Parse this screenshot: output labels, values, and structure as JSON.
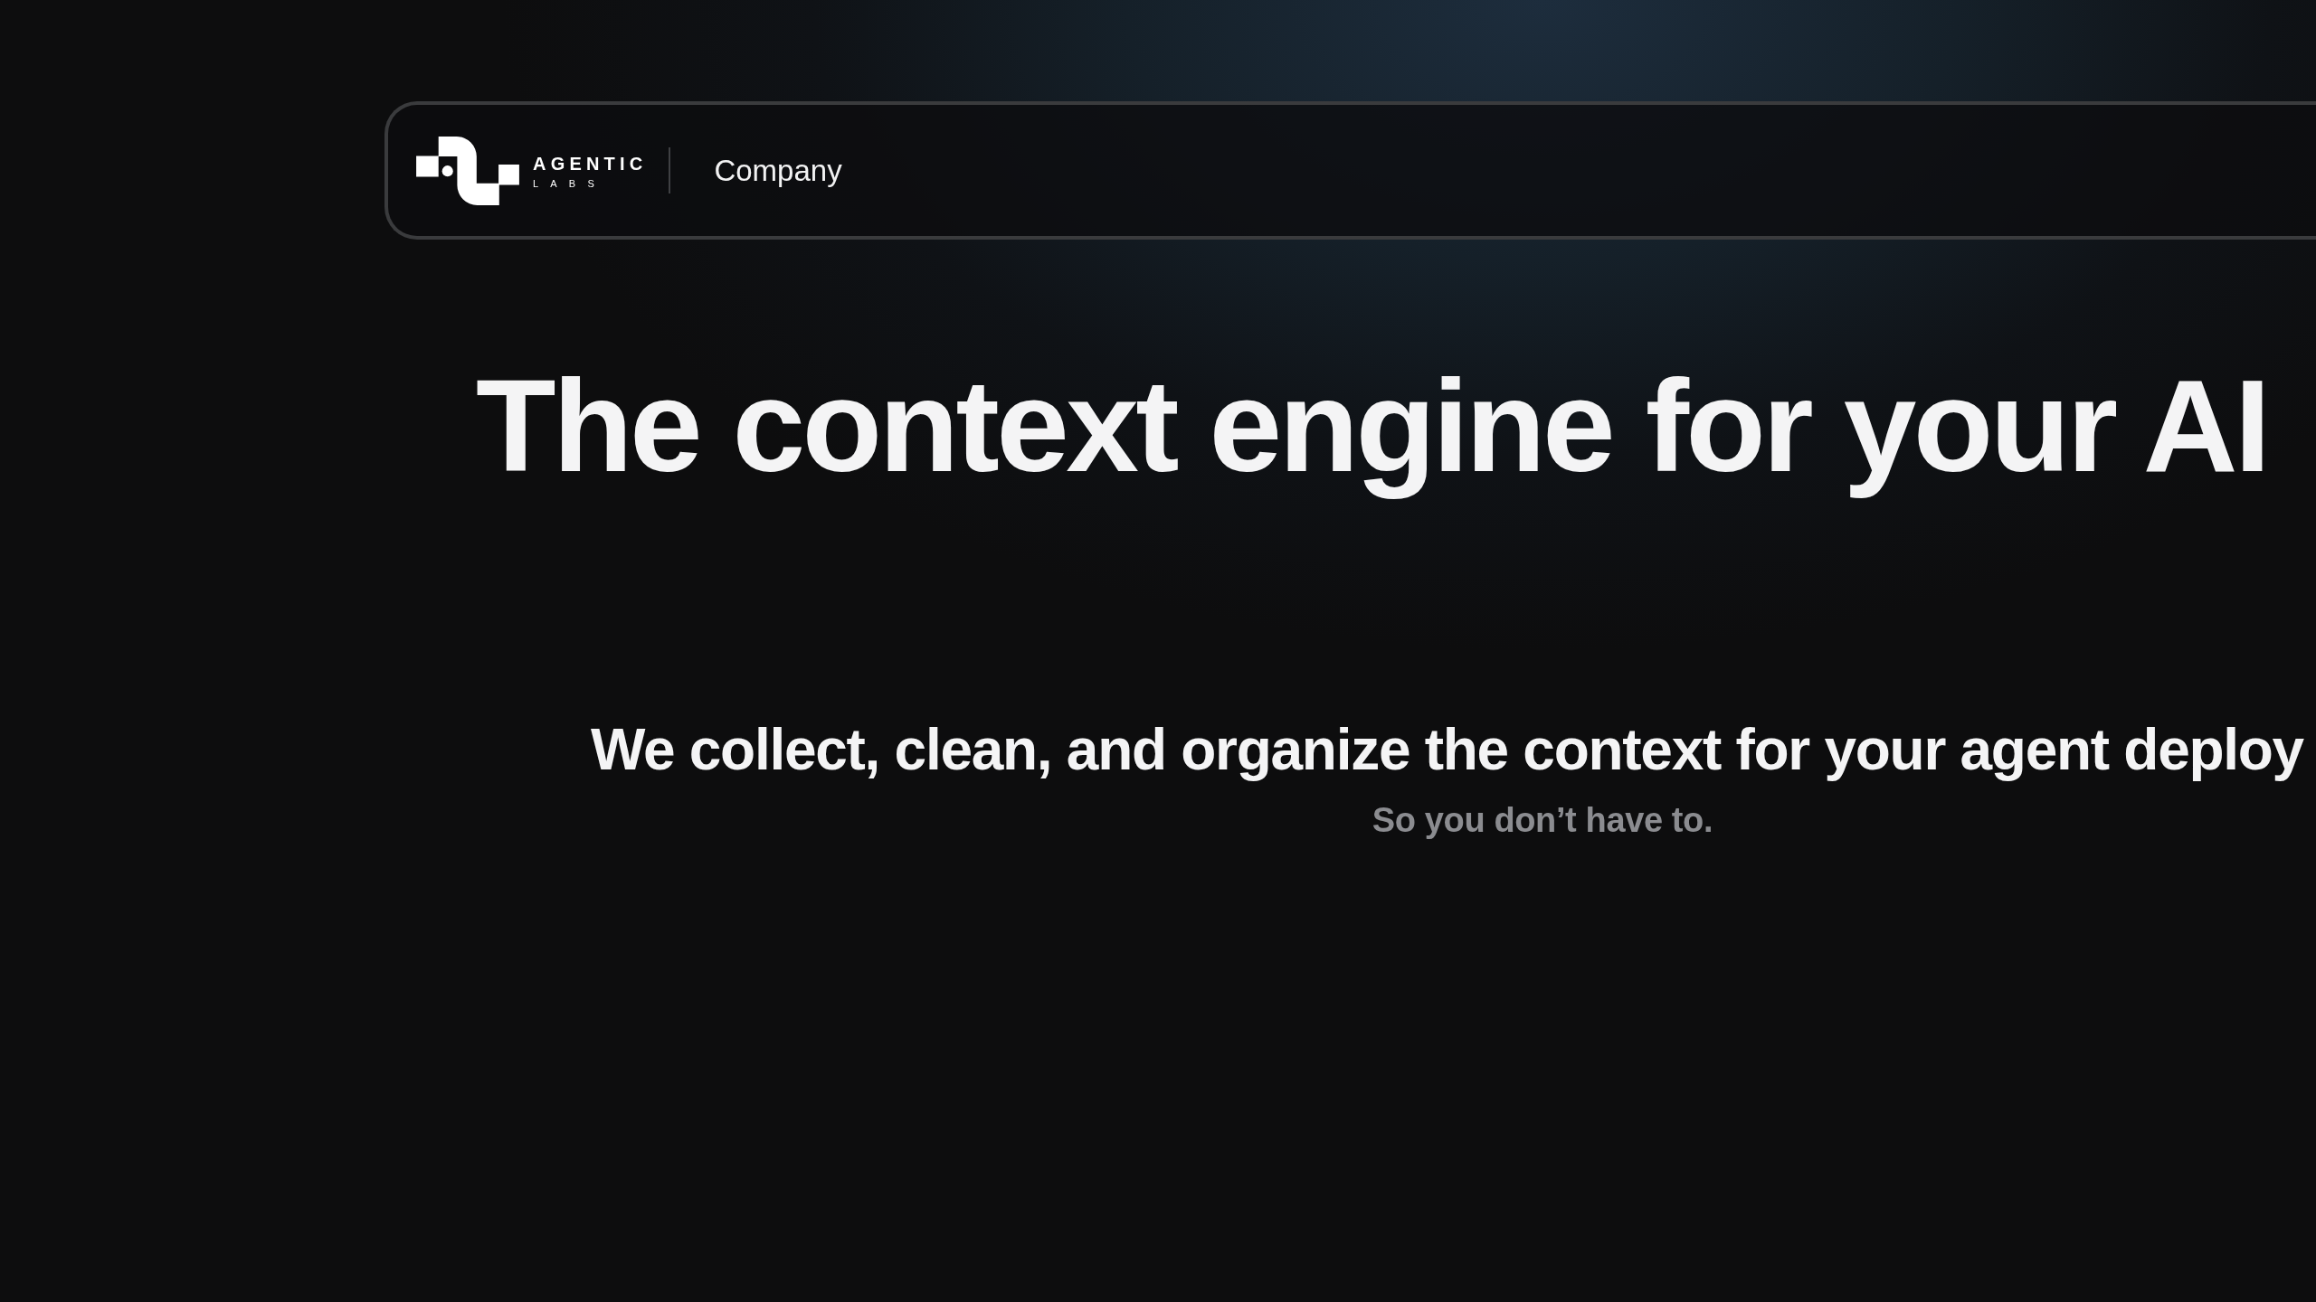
{
  "nav": {
    "brand": {
      "name": "AGENTIC",
      "tagline": "LABS"
    },
    "links": [
      {
        "label": "Company"
      }
    ]
  },
  "hero": {
    "title": "The context engine for your AI",
    "subtitle": "We collect, clean, and organize the context for your agent deploy",
    "note": "So you don’t have to."
  }
}
